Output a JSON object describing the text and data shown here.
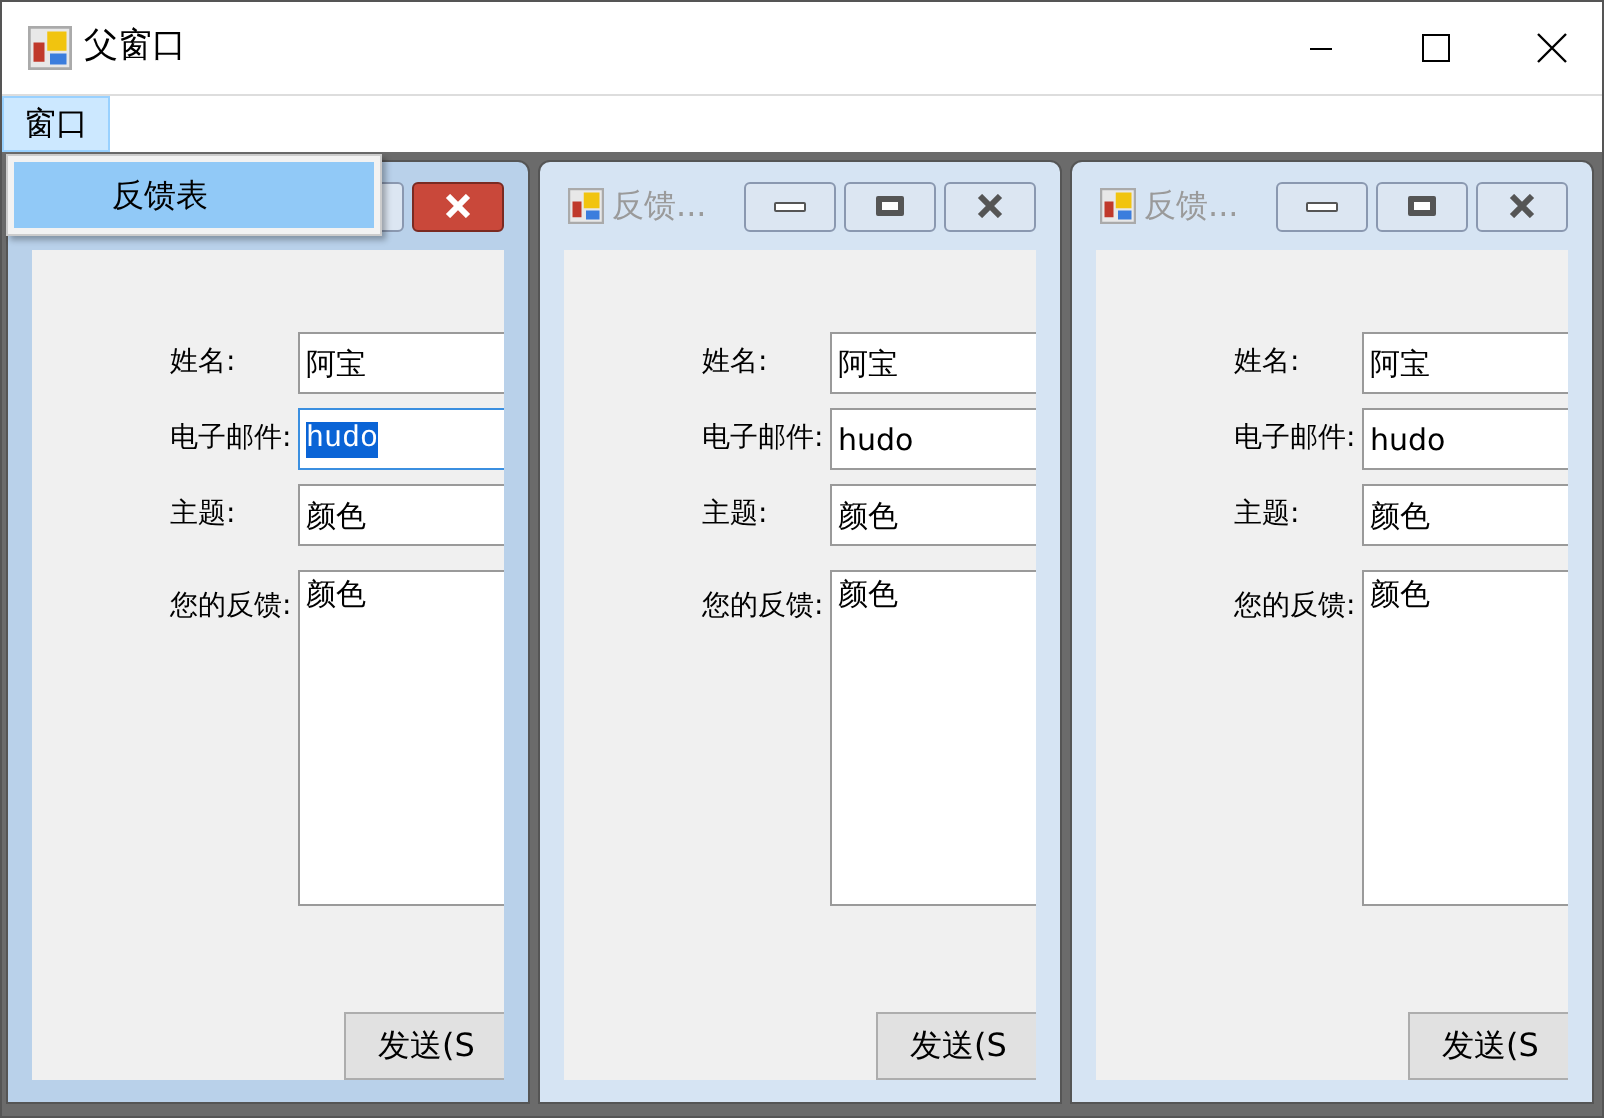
{
  "window": {
    "title": "父窗口"
  },
  "menu": [
    {
      "label": "窗口",
      "selected": true
    }
  ],
  "dropdown": [
    {
      "label": "反馈表",
      "selected": true
    }
  ],
  "children": [
    {
      "active": true,
      "fields": [
        {
          "kind": "text",
          "label": "姓名:",
          "value": "阿宝",
          "selected": false
        },
        {
          "kind": "text",
          "label": "电子邮件:",
          "value": "hudo",
          "selected": true
        },
        {
          "kind": "text",
          "label": "主题:",
          "value": "颜色",
          "selected": false
        },
        {
          "kind": "multiline",
          "label": "您的反馈:",
          "value": "颜色",
          "selected": false
        }
      ],
      "button": "发送(S"
    },
    {
      "active": false,
      "title": "反馈...",
      "fields": [
        {
          "kind": "text",
          "label": "姓名:",
          "value": "阿宝",
          "selected": false
        },
        {
          "kind": "text",
          "label": "电子邮件:",
          "value": "hudo",
          "selected": false
        },
        {
          "kind": "text",
          "label": "主题:",
          "value": "颜色",
          "selected": false
        },
        {
          "kind": "multiline",
          "label": "您的反馈:",
          "value": "颜色",
          "selected": false
        }
      ],
      "button": "发送(S"
    },
    {
      "active": false,
      "title": "反馈...",
      "fields": [
        {
          "kind": "text",
          "label": "姓名:",
          "value": "阿宝",
          "selected": false
        },
        {
          "kind": "text",
          "label": "电子邮件:",
          "value": "hudo",
          "selected": false
        },
        {
          "kind": "text",
          "label": "主题:",
          "value": "颜色",
          "selected": false
        },
        {
          "kind": "multiline",
          "label": "您的反馈:",
          "value": "颜色",
          "selected": false
        }
      ],
      "button": "发送(S"
    }
  ]
}
